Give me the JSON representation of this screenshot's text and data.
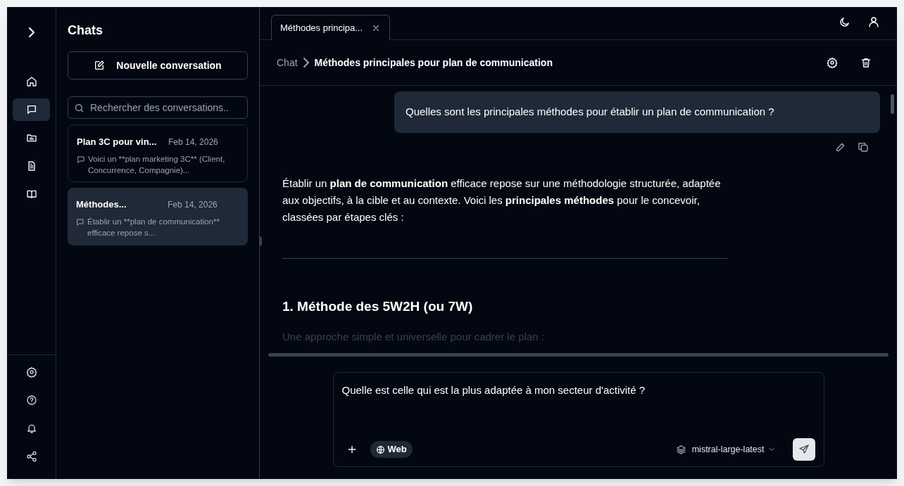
{
  "rail": {
    "top": [
      {
        "kind": "home",
        "selected": false
      },
      {
        "kind": "chat",
        "selected": true
      },
      {
        "kind": "folder",
        "selected": false
      },
      {
        "kind": "document",
        "selected": false
      },
      {
        "kind": "book",
        "selected": false
      }
    ],
    "bottom": [
      {
        "kind": "settings"
      },
      {
        "kind": "help"
      },
      {
        "kind": "bell"
      },
      {
        "kind": "share"
      }
    ]
  },
  "sidebar": {
    "title": "Chats",
    "new_button": "Nouvelle conversation",
    "search": {
      "placeholder": "Rechercher des conversations.."
    },
    "conversations": [
      {
        "title": "Plan 3C pour vin...",
        "date": "Feb 14, 2026",
        "preview": "Voici un **plan marketing 3C** (Client, Concurrence, Compagnie)...",
        "selected": false
      },
      {
        "title": "Méthodes...",
        "date": "Feb 14, 2026",
        "preview": "Établir un **plan de communication** efficace repose s...",
        "selected": true
      }
    ]
  },
  "tabs": [
    {
      "label": "Méthodes principa...",
      "selected": true
    }
  ],
  "breadcrumb": {
    "parent": "Chat",
    "current": "Méthodes principales pour plan de communication"
  },
  "messages": [
    {
      "kind": "user",
      "text": "Quelles sont les principales méthodes pour établir un plan de communication ?"
    },
    {
      "kind": "assistant",
      "blocks": [
        {
          "kind": "paragraph",
          "text": "Établir un **plan de communication** efficace repose sur une méthodologie structurée, adaptée aux objectifs, à la cible et au contexte. Voici les **principales méthodes** pour le concevoir, classées par étapes clés :"
        },
        {
          "kind": "rule"
        },
        {
          "kind": "heading",
          "text": "1. Méthode des 5W2H (ou 7W)"
        },
        {
          "kind": "faded",
          "text": "Une approche simple et universelle pour cadrer le plan :"
        }
      ]
    }
  ],
  "composer": {
    "value": "Quelle est celle qui est la plus adaptée à mon secteur d'activité ?",
    "web_chip": "Web",
    "model": "mistral-large-latest"
  }
}
